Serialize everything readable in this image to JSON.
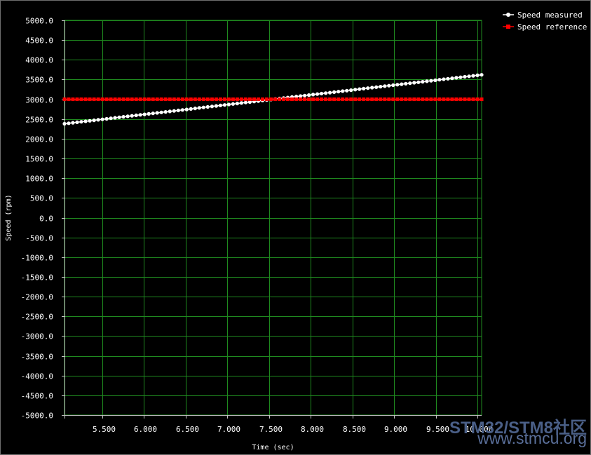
{
  "chart_data": {
    "type": "line",
    "xlabel": "Time (sec)",
    "ylabel": "Speed (rpm)",
    "xlim": [
      5.05,
      10.05
    ],
    "ylim": [
      -5000,
      5000
    ],
    "x_ticks": [
      5.5,
      6.0,
      6.5,
      7.0,
      7.5,
      8.0,
      8.5,
      9.0,
      9.5,
      10.0
    ],
    "x_tick_labels": [
      "5.500",
      "6.000",
      "6.500",
      "7.000",
      "7.500",
      "8.000",
      "8.500",
      "9.000",
      "9.500",
      "10.000"
    ],
    "y_ticks": [
      5000,
      4500,
      4000,
      3500,
      3000,
      2500,
      2000,
      1500,
      1000,
      500,
      0,
      -500,
      -1000,
      -1500,
      -2000,
      -2500,
      -3000,
      -3500,
      -4000,
      -4500,
      -5000
    ],
    "y_tick_labels": [
      "5000.0",
      "4500.0",
      "4000.0",
      "3500.0",
      "3000.0",
      "2500.0",
      "2000.0",
      "1500.0",
      "1000.0",
      "500.0",
      "0.0",
      "-500.0",
      "-1000.0",
      "-1500.0",
      "-2000.0",
      "-2500.0",
      "-3000.0",
      "-3500.0",
      "-4000.0",
      "-4500.0",
      "-5000.0"
    ],
    "grid": true,
    "legend_position": "top-right",
    "series": [
      {
        "name": "Speed measured",
        "color": "#ffffff",
        "marker": "circle",
        "x_start": 5.05,
        "x_end": 10.05,
        "points": 100,
        "y_start": 2380,
        "y_end": 3620
      },
      {
        "name": "Speed reference",
        "color": "#ff0000",
        "marker": "square",
        "x_start": 5.05,
        "x_end": 10.05,
        "points": 100,
        "y_start": 3000,
        "y_end": 3000
      }
    ],
    "colors": {
      "background": "#000000",
      "grid": "#1f8a1f",
      "axis_text": "#ffffff"
    }
  },
  "watermark": {
    "line1": "STM32/STM8社区",
    "line2": "www.stmcu.org"
  }
}
